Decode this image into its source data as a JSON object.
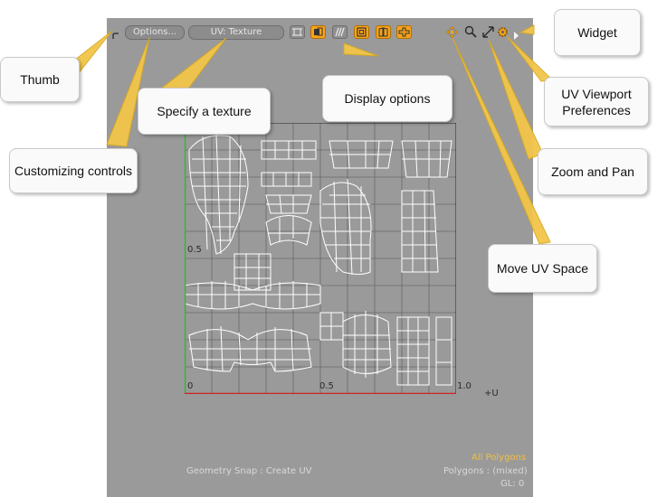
{
  "toolbar": {
    "options_label": "Options...",
    "texture_label": "UV: Texture"
  },
  "axes": {
    "u_zero": "0",
    "u_half": "0.5",
    "u_one": "1.0",
    "u_axis": "+U",
    "v_half": "0.5"
  },
  "status": {
    "geometry_snap": "Geometry Snap : Create UV",
    "selection": "All Polygons",
    "polygons": "Polygons : (mixed)",
    "gl": "GL: 0"
  },
  "callouts": {
    "thumb": "Thumb",
    "customizing": "Customizing controls",
    "specify_texture": "Specify a texture",
    "display_options": "Display options",
    "widget": "Widget",
    "uv_prefs_line1": "UV Viewport",
    "uv_prefs_line2": "Preferences",
    "zoom_pan": "Zoom and Pan",
    "move_uv": "Move UV Space"
  },
  "colors": {
    "viewport_bg": "#9a9a9a",
    "accent_orange": "#f5a31a",
    "u_axis_red": "#d02020",
    "v_axis_green": "#20c020",
    "selection_text": "#f2c040",
    "callout_line": "#f2c64a"
  },
  "icons": [
    "thumb-icon",
    "grid-icon",
    "texture-toggle-icon",
    "stripes-icon",
    "display-square-icon",
    "display-book-icon",
    "display-cross-icon",
    "move-icon",
    "zoom-icon",
    "pan-icon",
    "gear-icon",
    "widget-arrow-icon"
  ]
}
